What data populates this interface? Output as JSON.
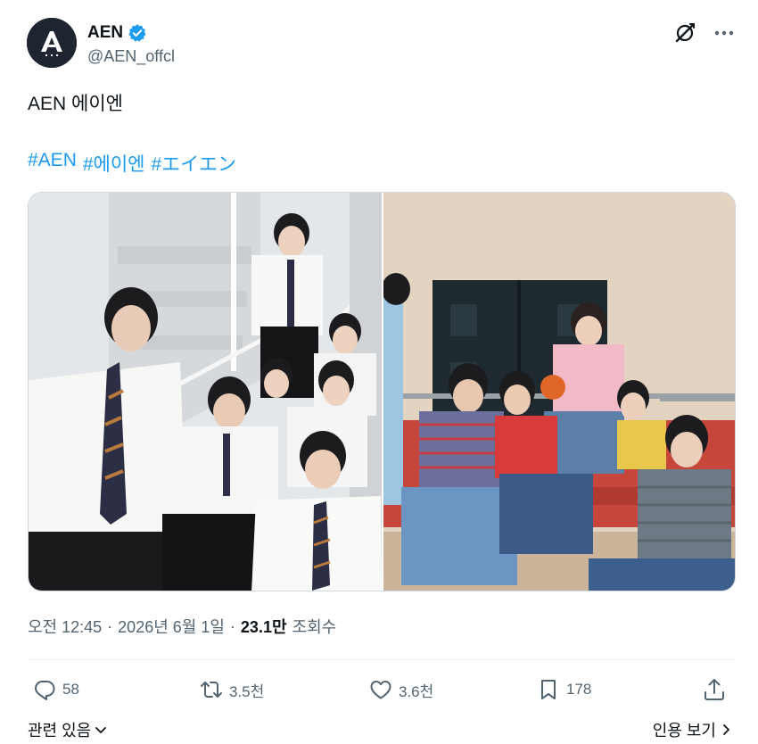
{
  "author": {
    "display_name": "AEN",
    "handle": "@AEN_offcl",
    "verified_icon": "verified-badge-icon",
    "avatar_logo_text": "A E N"
  },
  "top_actions": {
    "grok_icon": "grok-icon",
    "more_icon": "more-horizontal-icon"
  },
  "tweet": {
    "text": "AEN 에이엔",
    "hashtags": [
      "#AEN",
      "#에이엔",
      "#エイエン"
    ]
  },
  "media": {
    "count": 2
  },
  "meta": {
    "time": "오전 12:45",
    "date": "2026년 6월 1일",
    "views_count": "23.1만",
    "views_label": "조회수",
    "separator": "·"
  },
  "actions": {
    "reply_count": "58",
    "repost_count": "3.5천",
    "like_count": "3.6천",
    "bookmark_count": "178"
  },
  "footer": {
    "related_label": "관련 있음",
    "see_more_label": "인용 보기"
  },
  "colors": {
    "accent": "#1d9bf0",
    "text_primary": "#0f1419",
    "text_secondary": "#536471",
    "border": "#cfd9de"
  }
}
